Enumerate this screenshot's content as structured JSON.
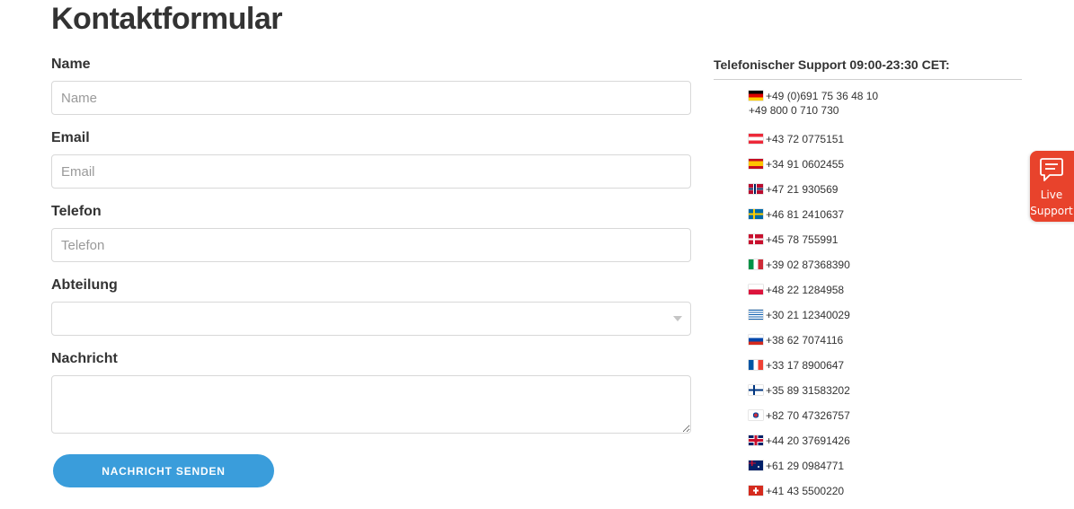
{
  "page": {
    "title": "Kontaktformular"
  },
  "form": {
    "name": {
      "label": "Name",
      "placeholder": "Name"
    },
    "email": {
      "label": "Email",
      "placeholder": "Email"
    },
    "phone": {
      "label": "Telefon",
      "placeholder": "Telefon"
    },
    "department": {
      "label": "Abteilung",
      "selected": ""
    },
    "message": {
      "label": "Nachricht",
      "value": ""
    },
    "submit_label": "NACHRICHT SENDEN"
  },
  "support": {
    "heading": "Telefonischer Support 09:00-23:30 CET:",
    "phones": [
      {
        "flag": "germany-flag-icon",
        "numbers": [
          "+49 (0)691 75 36 48 10",
          "+49 800 0 710 730"
        ]
      },
      {
        "flag": "austria-flag-icon",
        "numbers": [
          "+43 72 0775151"
        ]
      },
      {
        "flag": "spain-flag-icon",
        "numbers": [
          "+34 91 0602455"
        ]
      },
      {
        "flag": "norway-flag-icon",
        "numbers": [
          "+47 21 930569"
        ]
      },
      {
        "flag": "sweden-flag-icon",
        "numbers": [
          "+46 81 2410637"
        ]
      },
      {
        "flag": "denmark-flag-icon",
        "numbers": [
          "+45 78 755991"
        ]
      },
      {
        "flag": "italy-flag-icon",
        "numbers": [
          "+39 02 87368390"
        ]
      },
      {
        "flag": "poland-flag-icon",
        "numbers": [
          "+48 22 1284958"
        ]
      },
      {
        "flag": "greece-flag-icon",
        "numbers": [
          "+30 21 12340029"
        ]
      },
      {
        "flag": "slovenia-flag-icon",
        "numbers": [
          "+38 62 7074116"
        ]
      },
      {
        "flag": "france-flag-icon",
        "numbers": [
          "+33 17 8900647"
        ]
      },
      {
        "flag": "finland-flag-icon",
        "numbers": [
          "+35 89 31583202"
        ]
      },
      {
        "flag": "south-korea-flag-icon",
        "numbers": [
          "+82 70 47326757"
        ]
      },
      {
        "flag": "uk-flag-icon",
        "numbers": [
          "+44 20 37691426"
        ]
      },
      {
        "flag": "australia-flag-icon",
        "numbers": [
          "+61 29 0984771"
        ]
      },
      {
        "flag": "switzerland-flag-icon",
        "numbers": [
          "+41 43 5500220"
        ]
      }
    ]
  },
  "live_support": {
    "line1": "Live",
    "line2": "Support",
    "icon": "chat-bubble-icon",
    "color": "#e8432c"
  },
  "colors": {
    "button": "#3a9ddb",
    "text": "#333333",
    "border": "#d8d8d8"
  }
}
